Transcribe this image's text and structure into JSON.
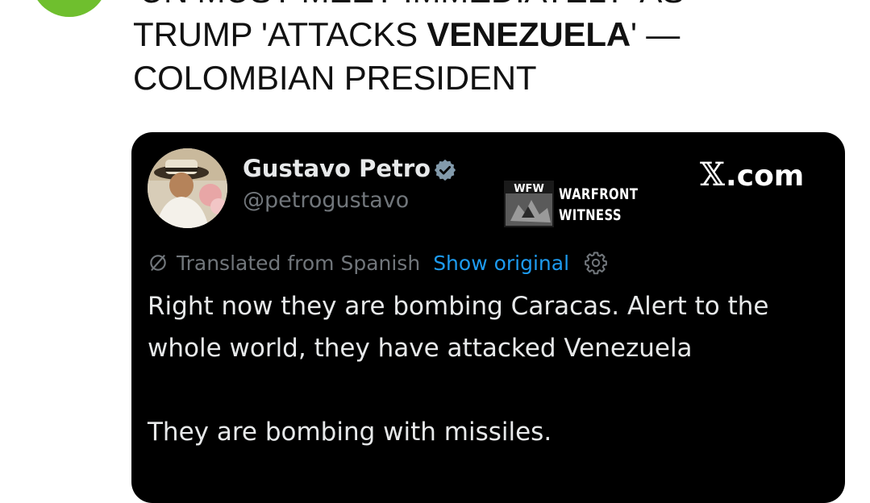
{
  "headline": {
    "line1": "'UN MUST MEET IMMEDIATELY' AS",
    "line2_pre": "TRUMP 'ATTACKS ",
    "line2_bold": "VENEZUELA",
    "line2_post": "' —",
    "line3": "COLOMBIAN PRESIDENT"
  },
  "embed": {
    "author_name": "Gustavo Petro",
    "author_handle": "@petrogustavo",
    "watermark": {
      "logo_text": "WFW",
      "line1": "WARFRONT",
      "line2": "WITNESS"
    },
    "source": {
      "prefix": "𝕏",
      "suffix": ".com"
    },
    "translated_label": "Translated from Spanish",
    "show_original_label": "Show original",
    "tweet_text": {
      "para1": "Right now they are bombing Caracas. Alert to the whole world, they have attacked Venezuela",
      "para2": "They are bombing with missiles."
    }
  },
  "colors": {
    "poster_avatar": "#6fbf2e",
    "embed_bg": "#000000",
    "link": "#1d9bf0",
    "muted": "#71767b",
    "tweet_text": "#e7e9ea"
  },
  "icons": {
    "verified": "verified-badge-icon",
    "translate": "translate-icon",
    "settings": "gear-icon"
  }
}
